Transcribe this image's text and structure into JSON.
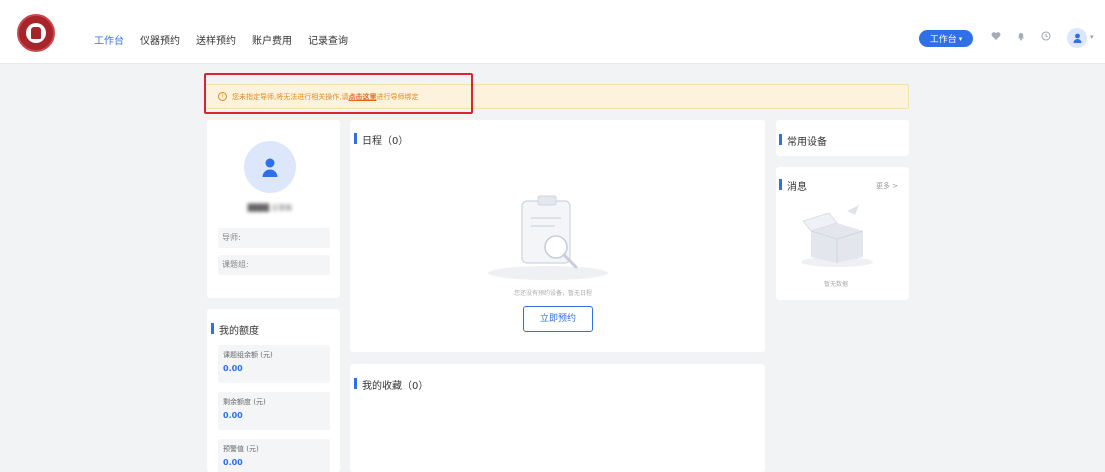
{
  "nav": {
    "items": [
      {
        "label": "工作台",
        "active": true
      },
      {
        "label": "仪器预约",
        "active": false
      },
      {
        "label": "送样预约",
        "active": false
      },
      {
        "label": "账户费用",
        "active": false
      },
      {
        "label": "记录查询",
        "active": false
      }
    ]
  },
  "header": {
    "workbench_label": "工作台",
    "workbench_caret": "▾",
    "icons": [
      "heart-icon",
      "bell-icon",
      "clock-icon",
      "user-icon"
    ]
  },
  "warning": {
    "text_before": "您未指定导师,将无法进行相关操作,请",
    "link_text": "点击这里",
    "text_after": "进行导师绑定",
    "icon_glyph": "!"
  },
  "profile": {
    "avatar_glyph": "👤",
    "username": "████ 主管账",
    "advisor_label": "导师:",
    "group_label": "课题组:"
  },
  "quota": {
    "title": "我的额度",
    "items": [
      {
        "label": "课题组余额 (元)",
        "value": "0.00"
      },
      {
        "label": "剩余额度 (元)",
        "value": "0.00"
      },
      {
        "label": "预警值 (元)",
        "value": "0.00"
      }
    ]
  },
  "schedule": {
    "title": "日程（0）",
    "empty_text": "您还没有预约设备，暂无日程",
    "book_button": "立即预约"
  },
  "favorites": {
    "title": "我的收藏（0）"
  },
  "common_devices": {
    "title": "常用设备"
  },
  "messages": {
    "title": "消息",
    "more": "更多 >",
    "empty_text": "暂无数据"
  },
  "colors": {
    "primary": "#2f6fe8",
    "warning_bg": "#fdf3dc",
    "warning_text": "#e38a1d",
    "highlight": "#d9252d",
    "brand": "#a8242b"
  }
}
